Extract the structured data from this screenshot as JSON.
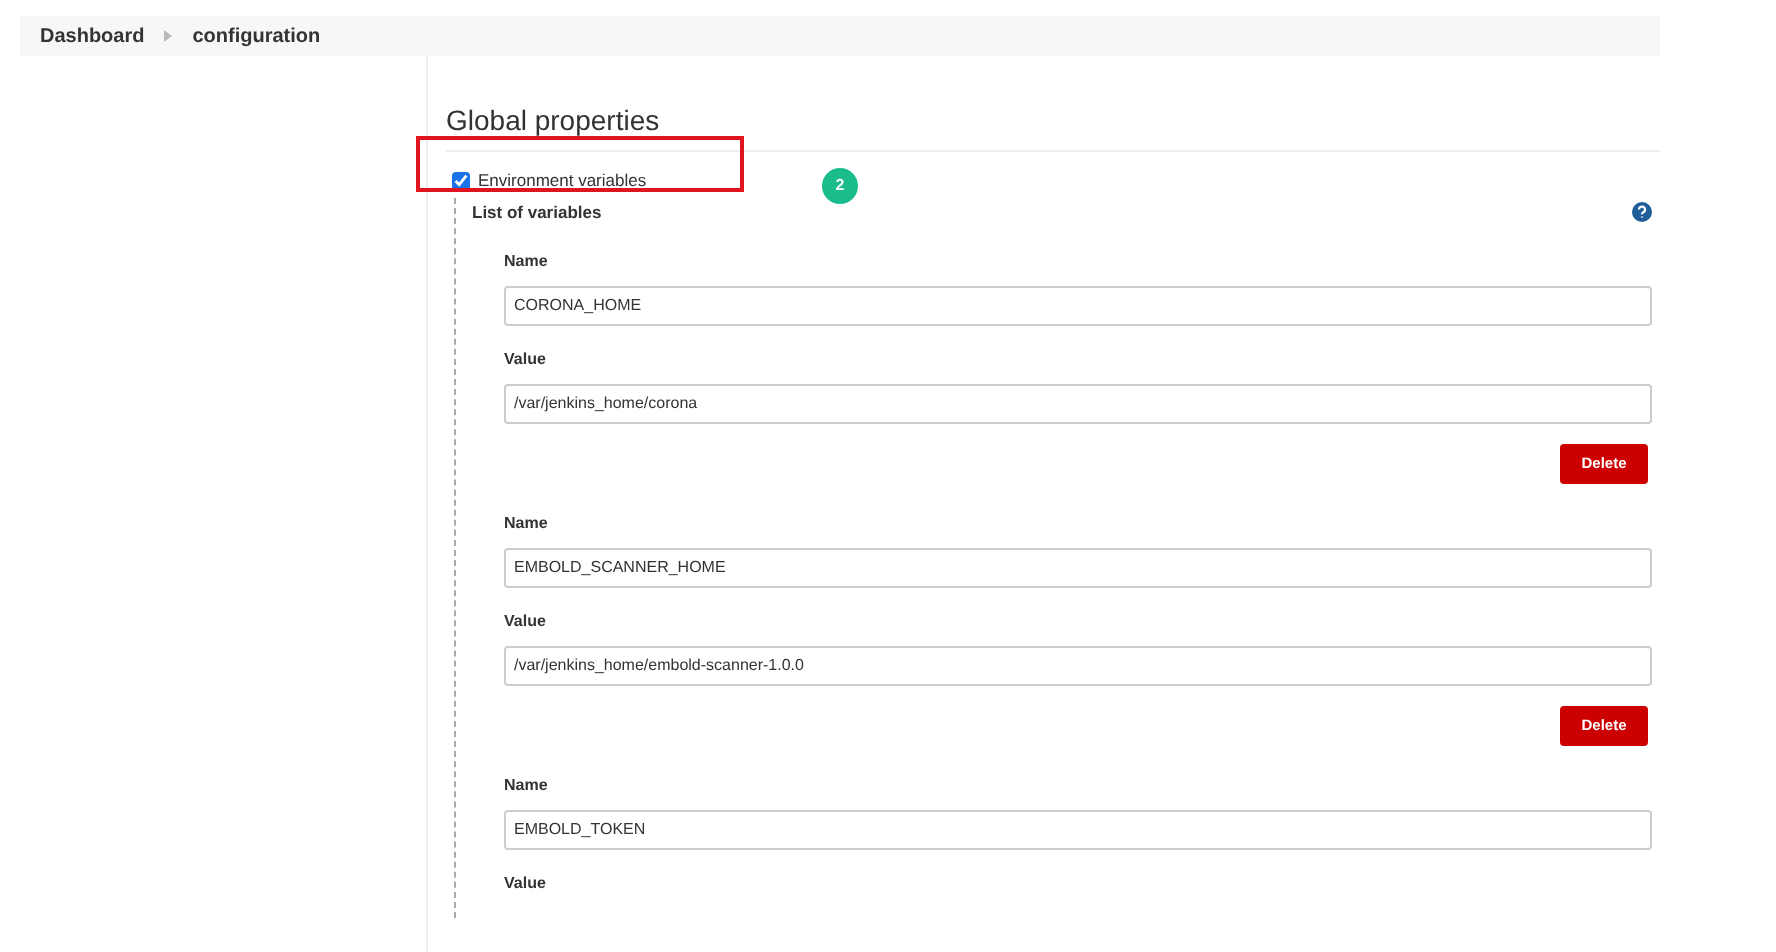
{
  "breadcrumbs": [
    {
      "label": "Dashboard"
    },
    {
      "label": "configuration"
    }
  ],
  "section": {
    "title": "Global properties"
  },
  "env_checkbox": {
    "label": "Environment variables",
    "checked": true
  },
  "callout_badge": "2",
  "list_label": "List of variables",
  "variables": [
    {
      "name_label": "Name",
      "name": "CORONA_HOME",
      "value_label": "Value",
      "value": "/var/jenkins_home/corona",
      "delete": "Delete"
    },
    {
      "name_label": "Name",
      "name": "EMBOLD_SCANNER_HOME",
      "value_label": "Value",
      "value": "/var/jenkins_home/embold-scanner-1.0.0",
      "delete": "Delete"
    },
    {
      "name_label": "Name",
      "name": "EMBOLD_TOKEN",
      "value_label": "Value"
    }
  ]
}
